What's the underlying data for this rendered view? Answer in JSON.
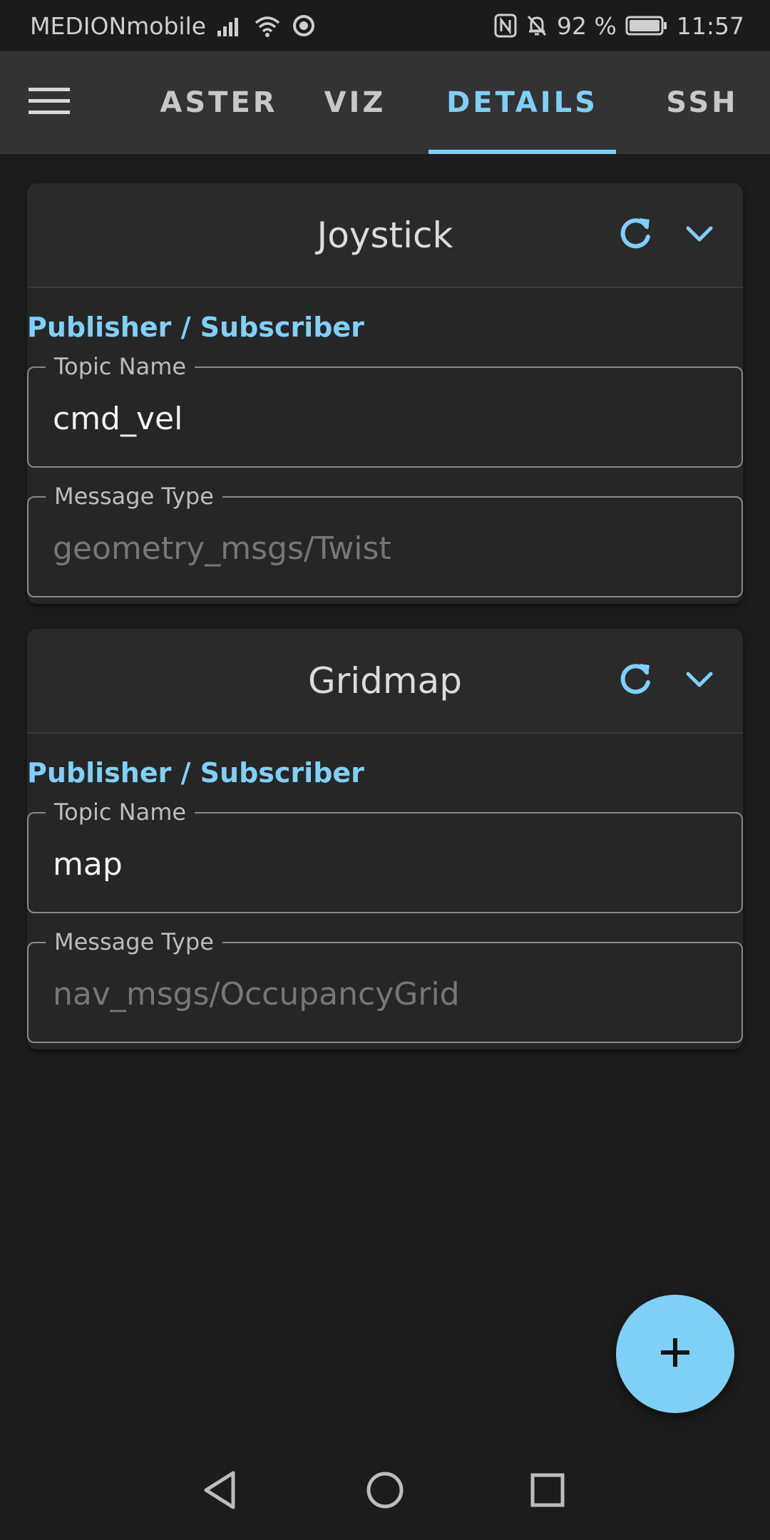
{
  "status_bar": {
    "carrier": "MEDIONmobile",
    "battery_percent": "92 %",
    "time": "11:57",
    "icons": [
      "signal-icon",
      "wifi-icon",
      "sync-icon",
      "nfc-icon",
      "bell-off-icon",
      "battery-icon"
    ]
  },
  "app_bar": {
    "menu_icon": "hamburger-menu-icon",
    "tabs": [
      {
        "label": "ASTER",
        "active": false
      },
      {
        "label": "VIZ",
        "active": false
      },
      {
        "label": "DETAILS",
        "active": true
      },
      {
        "label": "SSH",
        "active": false
      }
    ]
  },
  "cards": [
    {
      "title": "Joystick",
      "section_label": "Publisher / Subscriber",
      "fields": [
        {
          "label": "Topic Name",
          "value": "cmd_vel",
          "disabled": false
        },
        {
          "label": "Message Type",
          "value": "geometry_msgs/Twist",
          "disabled": true
        }
      ]
    },
    {
      "title": "Gridmap",
      "section_label": "Publisher / Subscriber",
      "fields": [
        {
          "label": "Topic Name",
          "value": "map",
          "disabled": false
        },
        {
          "label": "Message Type",
          "value": "nav_msgs/OccupancyGrid",
          "disabled": true
        }
      ]
    }
  ],
  "fab": {
    "icon": "plus-icon"
  },
  "nav_bar": {
    "icons": [
      "back-triangle-icon",
      "home-circle-icon",
      "recents-square-icon"
    ]
  },
  "colors": {
    "accent": "#7fd0f6",
    "background": "#1c1c1c",
    "app_bar": "#333333",
    "card": "#262626"
  }
}
